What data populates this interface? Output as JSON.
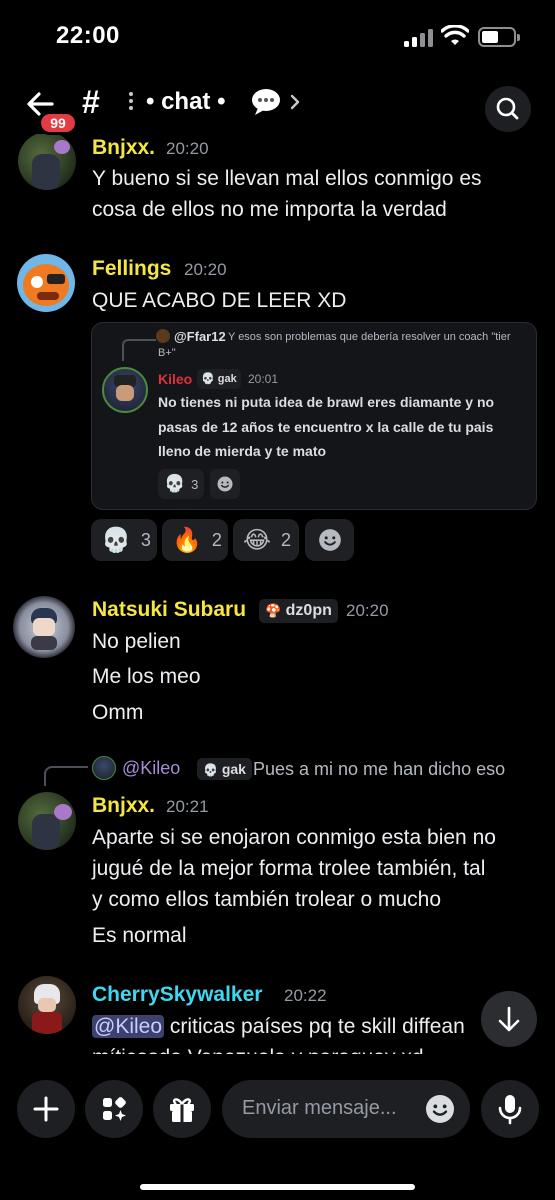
{
  "status_bar": {
    "time": "22:00"
  },
  "header": {
    "unread_badge": "99",
    "channel_name": "chat",
    "channel_separator": "•"
  },
  "messages": [
    {
      "author": "Bnjxx.",
      "time": "20:20",
      "author_color": "#f5e642",
      "lines": [
        "Y bueno si se llevan mal ellos conmigo es",
        "cosa de ellos no me importa la verdad"
      ]
    },
    {
      "author": "Fellings",
      "time": "20:20",
      "author_color": "#f5e642",
      "lines": [
        "QUE ACABO DE LEER XD"
      ],
      "forwarded": {
        "reply_author": "@Ffar12",
        "reply_text": "Y esos son problemas que debería resolver un coach \"tier",
        "reply_text_2": "B+\"",
        "author": "Kileo",
        "author_color": "#e0303e",
        "tag": "gak",
        "time": "20:01",
        "lines": [
          "No tienes ni puta idea de brawl eres diamante y no",
          "pasas de 12 años te encuentro x la calle de tu pais",
          "lleno de mierda y te mato"
        ],
        "reactions": [
          {
            "icon": "skull",
            "count": "3"
          }
        ]
      },
      "reactions": [
        {
          "icon": "skull",
          "count": "3"
        },
        {
          "icon": "fire",
          "count": "2"
        },
        {
          "icon": "joy",
          "count": "2"
        }
      ]
    },
    {
      "author": "Natsuki Subaru",
      "time": "20:20",
      "author_color": "#f5e642",
      "tag": "dz0pn",
      "lines": [
        "No pelien",
        "Me los meo",
        "Omm"
      ]
    },
    {
      "reply": {
        "author": "@Kileo",
        "tag": "gak",
        "text": "Pues a mi no me han dicho eso"
      },
      "author": "Bnjxx.",
      "time": "20:21",
      "author_color": "#f5e642",
      "lines": [
        "Aparte si se enojaron conmigo esta bien no",
        "jugué de la mejor forma trolee también, tal",
        "y como ellos también trolear o mucho",
        "Es normal"
      ]
    },
    {
      "author": "CherrySkywalker",
      "time": "20:22",
      "author_color": "#3fd7f0",
      "mention": "@Kileo",
      "lines": [
        " criticas países pq te skill diffean",
        "míticosde Venezuela y paraguay xd"
      ]
    }
  ],
  "composer": {
    "placeholder": "Enviar mensaje..."
  },
  "icons": {
    "back": "arrow-left-icon",
    "hash": "hash-icon",
    "search": "search-icon",
    "plus": "plus-icon",
    "apps": "apps-icon",
    "gift": "gift-icon",
    "emoji": "emoji-icon",
    "mic": "microphone-icon",
    "scroll": "arrow-down-icon"
  }
}
